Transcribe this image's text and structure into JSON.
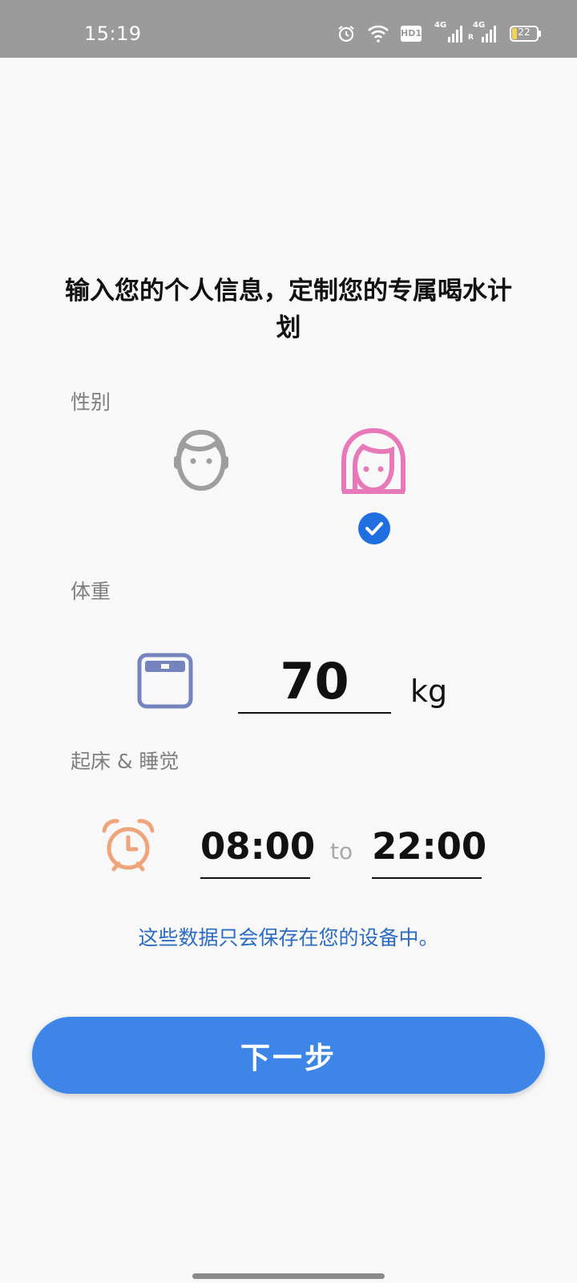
{
  "status_bar": {
    "time": "15:19",
    "battery": "22",
    "network_1": "4G",
    "network_2": "4G",
    "hd_label": "HD1",
    "icons": [
      "alarm-icon",
      "wifi-icon",
      "hd-icon",
      "signal-4g-icon",
      "signal-4g-r-icon",
      "battery-icon"
    ]
  },
  "headline": "输入您的个人信息，定制您的专属喝水计划",
  "gender": {
    "label": "性别",
    "options": [
      {
        "name": "male",
        "icon": "male-face-icon",
        "selected": false,
        "color": "#9e9e9e"
      },
      {
        "name": "female",
        "icon": "female-face-icon",
        "selected": true,
        "color": "#e879b9"
      }
    ],
    "check_color": "#1f6fe0"
  },
  "weight": {
    "label": "体重",
    "icon": "scale-icon",
    "value": "70",
    "unit": "kg",
    "icon_color": "#7584bf"
  },
  "schedule": {
    "label": "起床 & 睡觉",
    "icon": "alarm-clock-icon",
    "wake_time": "08:00",
    "separator": "to",
    "sleep_time": "22:00",
    "icon_color": "#efa57c"
  },
  "privacy_note": "这些数据只会保存在您的设备中。",
  "next_button": {
    "label": "下一步",
    "color": "#3d86e8"
  }
}
